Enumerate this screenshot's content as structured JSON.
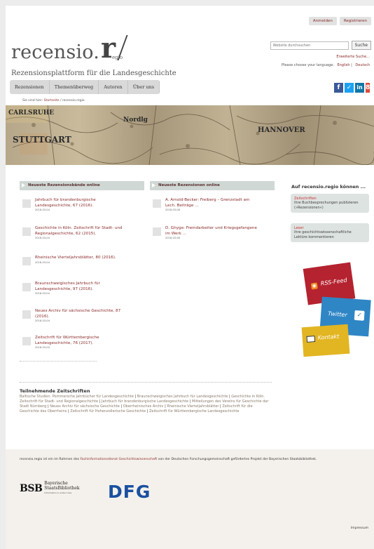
{
  "header": {
    "buttons": [
      "Anmelden",
      "Registrieren"
    ],
    "logo_text": "recensio.",
    "logo_mark": "r",
    "logo_suffix": "egio",
    "subtitle": "Rezensionsplattform für die Landesgeschichte",
    "search_placeholder": "Website durchsuchen",
    "search_button": "Suche",
    "advanced_search": "Erweiterte Suche...",
    "language_prompt": "Please choose your language:",
    "languages": [
      "English",
      "Deutsch"
    ]
  },
  "nav": [
    "Rezensionen",
    "Themenüberweg",
    "Autoren",
    "Über uns"
  ],
  "breadcrumb": {
    "prefix": "Sie sind hier:",
    "home": "Startseite",
    "current": "recensio.regio"
  },
  "banner_labels": [
    "CARLSRUHE",
    "STUTTGART",
    "Nordlg",
    "HANNOVER"
  ],
  "left_column": {
    "heading": "Neueste Rezensionsbände online",
    "items": [
      {
        "title": "Jahrbuch für brandenburgische Landesgeschichte, 67 (2016).",
        "date": "2018-03-04"
      },
      {
        "title": "Geschichte in Köln. Zeitschrift für Stadt- und Regionalgeschichte, 62 (2015).",
        "date": "2018-03-04"
      },
      {
        "title": "Rheinische Vierteljahrsblätter, 80 (2016).",
        "date": "2018-03-04"
      },
      {
        "title": "Braunschweigisches Jahrbuch für Landesgeschichte, 97 (2016).",
        "date": "2018-03-04"
      },
      {
        "title": "Neues Archiv für sächsische Geschichte, 87 (2016).",
        "date": "2018-03-04"
      },
      {
        "title": "Zeitschrift für Württembergische Landesgeschichte, 76 (2017).",
        "date": "2018-03-04"
      }
    ]
  },
  "mid_column": {
    "heading": "Neueste Rezensionen online",
    "items": [
      {
        "title": "A. Arnold-Becker: Freiberg – Grenzstadt am Lech. Beiträge ...",
        "date": "2018-03-08"
      },
      {
        "title": "D. Ghyge: Fremdarbeiter und Kriegsgefangene im Werk ...",
        "date": "2018-03-08"
      }
    ]
  },
  "sidebar": {
    "heading": "Auf recensio.regio können ...",
    "boxes": [
      {
        "title": "Zeitschriften",
        "desc": "ihre Buchbesprechungen publizieren (»Rezensionen«)"
      },
      {
        "title": "Leser",
        "desc": "ihre geschichtswissenschaftliche Lektüre kommentieren"
      }
    ],
    "tiles": [
      {
        "label": "RSS-Feed",
        "icon": "rss-icon"
      },
      {
        "label": "Twitter",
        "icon": "twitter-icon"
      },
      {
        "label": "Kontakt",
        "icon": "mail-icon"
      }
    ]
  },
  "journals": {
    "heading": "Teilnehmende Zeitschriften",
    "items": [
      "Baltische Studien. Pommersche Jahrbücher für Landesgeschichte",
      "Braunschweigisches Jahrbuch für Landesgeschichte",
      "Geschichte in Köln. Zeitschrift für Stadt- und Regionalgeschichte",
      "Jahrbuch für brandenburgische Landesgeschichte",
      "Mitteilungen des Vereins für Geschichte der Stadt Nürnberg",
      "Neues Archiv für sächsische Geschichte",
      "Oberrheinisches Archiv",
      "Rheinische Vierteljahrsblätter",
      "Zeitschrift für die Geschichte des Oberrheins",
      "Zeitschrift für Hohenzollerische Geschichte",
      "Zeitschrift für Württembergische Landesgeschichte"
    ]
  },
  "footer": {
    "text_pre": "recensio.regio ist ein im Rahmen des ",
    "link": "Fachinformationsdienst Geschichtswissenschaft",
    "text_post": " von der Deutschen Forschungsgemeinschaft gefördertes Projekt der Bayerischen Staatsbibliothek.",
    "bsb_mark": "BSB",
    "bsb_name_1": "Bayerische",
    "bsb_name_2": "StaatsBibliothek",
    "bsb_tagline": "Information in erster Linie",
    "dfg": "DFG",
    "impressum": "Impressum"
  },
  "colors": {
    "brand_red": "#8a2a2a",
    "nav_bg": "#d9d9d9",
    "column_head_bg": "#cfd8d4",
    "dfg_blue": "#1a50a0"
  }
}
